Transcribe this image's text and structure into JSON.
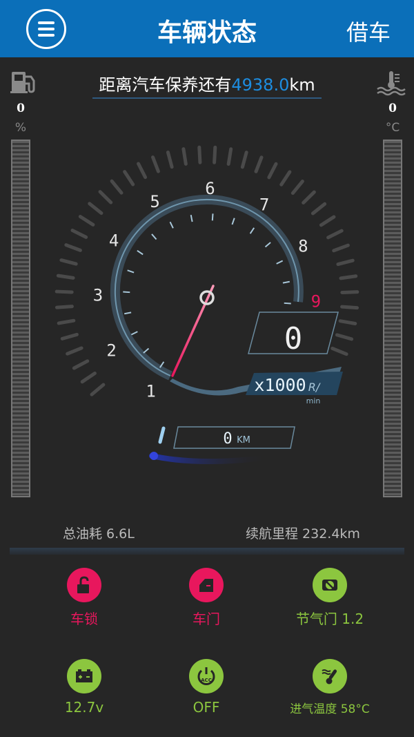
{
  "header": {
    "title": "车辆状态",
    "borrow_label": "借车"
  },
  "maintenance": {
    "prefix": "距离汽车保养还有",
    "value": "4938.0",
    "unit": "km"
  },
  "fuel": {
    "value": "0",
    "unit": "%",
    "icon": "fuel-pump-icon"
  },
  "coolant": {
    "value": "0",
    "unit": "°C",
    "icon": "coolant-temp-icon"
  },
  "tachometer": {
    "ticks": [
      "1",
      "2",
      "3",
      "4",
      "5",
      "6",
      "7",
      "8",
      "9"
    ],
    "speed": "0",
    "rpm_unit_multiplier": "x1000",
    "rpm_unit_a": "R/",
    "rpm_unit_b": "min",
    "odometer": "0",
    "odometer_unit": "KM"
  },
  "stats": {
    "fuel_consumption": "总油耗 6.6L",
    "range": "续航里程 232.4km"
  },
  "status_items": [
    {
      "label": "车锁",
      "icon": "unlocked-lock-icon",
      "color": "#e8175d"
    },
    {
      "label": "车门",
      "icon": "car-door-icon",
      "color": "#e8175d"
    },
    {
      "label": "节气门 1.2",
      "icon": "throttle-icon",
      "color": "#8cc63f"
    },
    {
      "label": "12.7v",
      "icon": "battery-icon",
      "color": "#8cc63f"
    },
    {
      "label": "OFF",
      "icon": "acc-power-icon",
      "color": "#8cc63f"
    },
    {
      "label": "进气温度 58°C",
      "icon": "intake-temp-icon",
      "color": "#8cc63f"
    }
  ],
  "colors": {
    "header_bg": "#0b6fb9",
    "accent_blue": "#1d8de0",
    "alert_red": "#e8175d",
    "ok_green": "#8cc63f",
    "background": "#262626"
  }
}
